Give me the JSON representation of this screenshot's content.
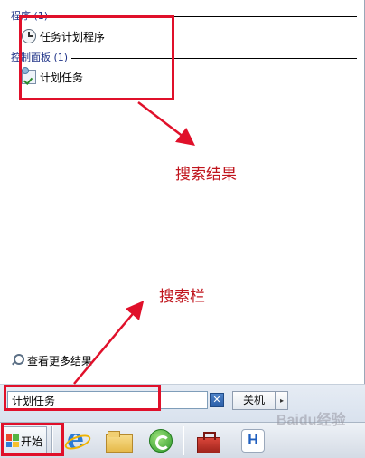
{
  "results": {
    "groups": [
      {
        "header": "程序 (1)",
        "items": [
          {
            "label": "任务计划程序",
            "icon": "clock-icon"
          }
        ]
      },
      {
        "header": "控制面板 (1)",
        "items": [
          {
            "label": "计划任务",
            "icon": "scheduled-task-icon"
          }
        ]
      }
    ],
    "more_results": "查看更多结果"
  },
  "search": {
    "value": "计划任务",
    "clear_glyph": "✕"
  },
  "shutdown": {
    "label": "关机",
    "arrow": "▸"
  },
  "taskbar": {
    "start_label": "开始",
    "apps": [
      "internet-explorer-icon",
      "folder-icon",
      "refresh-icon",
      "server-manager-icon",
      "h-app-icon"
    ],
    "h_app_letter": "H"
  },
  "annotations": {
    "results_label": "搜索结果",
    "searchbar_label": "搜索栏",
    "color": "#e0102a"
  },
  "watermark": {
    "text": "Baidu经验"
  }
}
